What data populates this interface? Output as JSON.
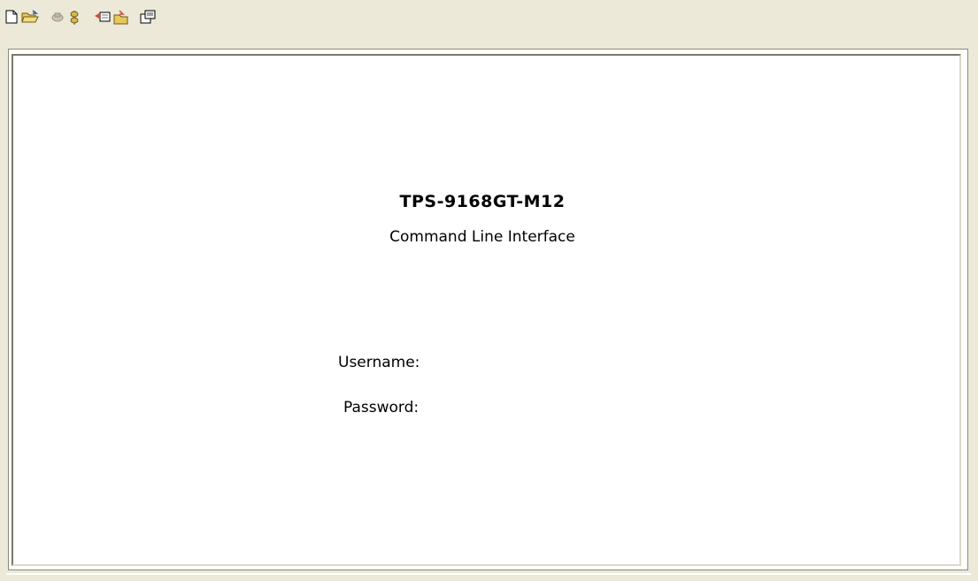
{
  "toolbar": {
    "buttons": [
      {
        "icon": "new-document-icon"
      },
      {
        "icon": "open-folder-icon"
      },
      {
        "icon": "connect-icon"
      },
      {
        "icon": "disconnect-icon"
      },
      {
        "icon": "send-icon"
      },
      {
        "icon": "receive-icon"
      },
      {
        "icon": "properties-icon"
      }
    ]
  },
  "terminal": {
    "title": "TPS-9168GT-M12",
    "subtitle": "Command Line Interface",
    "username_label": "Username:",
    "password_label": "Password:",
    "username_value": "",
    "password_value": ""
  }
}
